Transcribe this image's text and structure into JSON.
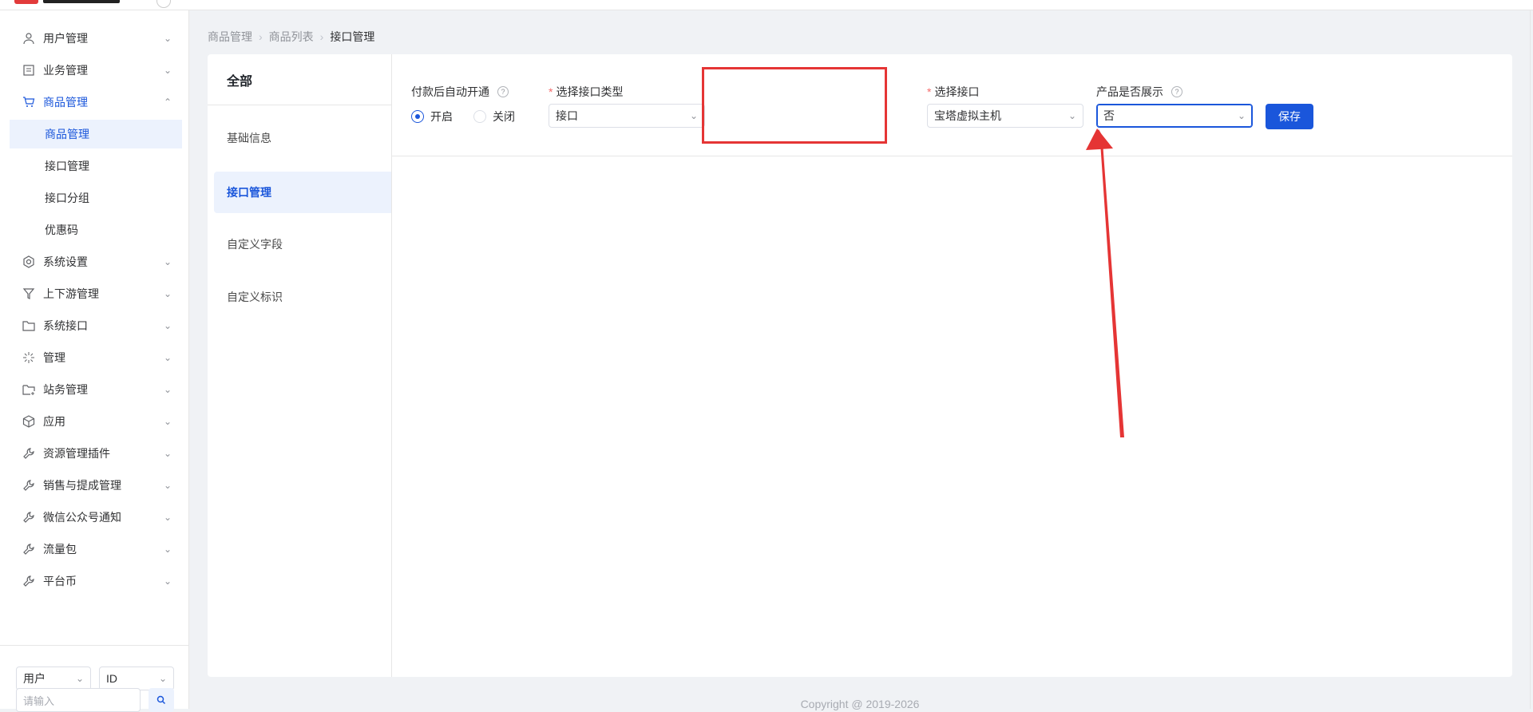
{
  "sidebar": {
    "items": [
      {
        "label": "用户管理",
        "icon": "user-icon",
        "expanded": false
      },
      {
        "label": "业务管理",
        "icon": "document-list-icon",
        "expanded": false
      },
      {
        "label": "商品管理",
        "icon": "cart-icon",
        "expanded": true
      },
      {
        "label": "系统设置",
        "icon": "gear-icon",
        "expanded": false
      },
      {
        "label": "上下游管理",
        "icon": "filter-icon",
        "expanded": false
      },
      {
        "label": "系统接口",
        "icon": "folder-icon",
        "expanded": false
      },
      {
        "label": "管理",
        "icon": "asterisk-icon",
        "expanded": false
      },
      {
        "label": "站务管理",
        "icon": "folder-add-icon",
        "expanded": false
      },
      {
        "label": "应用",
        "icon": "cube-icon",
        "expanded": false
      },
      {
        "label": "资源管理插件",
        "icon": "wrench-icon",
        "expanded": false
      },
      {
        "label": "销售与提成管理",
        "icon": "wrench-icon",
        "expanded": false
      },
      {
        "label": "微信公众号通知",
        "icon": "wrench-icon",
        "expanded": false
      },
      {
        "label": "流量包",
        "icon": "wrench-icon",
        "expanded": false
      },
      {
        "label": "平台币",
        "icon": "wrench-icon",
        "expanded": false
      }
    ],
    "sub_items": [
      {
        "label": "商品管理",
        "selected": true
      },
      {
        "label": "接口管理",
        "selected": false
      },
      {
        "label": "接口分组",
        "selected": false
      },
      {
        "label": "优惠码",
        "selected": false
      }
    ],
    "bottom": {
      "select1": "用户",
      "select2": "ID",
      "placeholder": "请输入"
    }
  },
  "breadcrumb": [
    "商品管理",
    "商品列表",
    "接口管理"
  ],
  "tabs": {
    "header": "全部",
    "items": [
      "基础信息",
      "接口管理",
      "自定义字段",
      "自定义标识"
    ],
    "active_index": 1
  },
  "form": {
    "auto_open_label": "付款后自动开通",
    "radio_on": "开启",
    "radio_off": "关闭",
    "interface_type_label": "选择接口类型",
    "interface_type_value": "接口",
    "interface_label": "选择接口",
    "interface_value": "宝塔虚拟主机",
    "show_label": "产品是否展示",
    "show_value": "否",
    "save_label": "保存"
  },
  "footer": "Copyright @ 2019-2026",
  "colors": {
    "primary": "#1a56db",
    "annotation": "#e53535"
  }
}
